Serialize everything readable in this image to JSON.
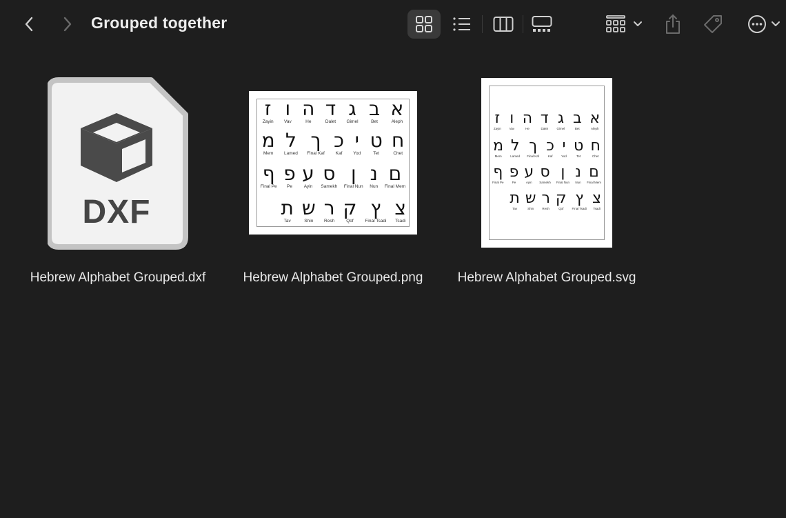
{
  "window": {
    "title": "Grouped together"
  },
  "toolbar": {
    "back": "chevron-left-icon",
    "forward": "chevron-right-icon",
    "views": [
      "grid-view-icon",
      "list-view-icon",
      "column-view-icon",
      "gallery-view-icon"
    ],
    "active_view": "grid",
    "group_by": "group-by-icon",
    "share": "share-icon",
    "tags": "tag-icon",
    "more": "ellipsis-circle-icon"
  },
  "files": [
    {
      "name": "Hebrew Alphabet Grouped.dxf",
      "kind": "document-icon",
      "icon_text": "DXF"
    },
    {
      "name": "Hebrew Alphabet Grouped.png",
      "kind": "image-thumbnail"
    },
    {
      "name": "Hebrew Alphabet Grouped.svg",
      "kind": "image-thumbnail"
    }
  ],
  "chart_sheet": {
    "rows": [
      [
        [
          "א",
          "Aleph"
        ],
        [
          "ב",
          "Bet"
        ],
        [
          "ג",
          "Gimel"
        ],
        [
          "ד",
          "Dalet"
        ],
        [
          "ה",
          "He"
        ],
        [
          "ו",
          "Vav"
        ],
        [
          "ז",
          "Zayin"
        ]
      ],
      [
        [
          "ח",
          "Chet"
        ],
        [
          "ט",
          "Tet"
        ],
        [
          "י",
          "Yod"
        ],
        [
          "כ",
          "Kaf"
        ],
        [
          "ך",
          "Final Kaf"
        ],
        [
          "ל",
          "Lamed"
        ],
        [
          "מ",
          "Mem"
        ]
      ],
      [
        [
          "ם",
          "Final Mem"
        ],
        [
          "נ",
          "Nun"
        ],
        [
          "ן",
          "Final Nun"
        ],
        [
          "ס",
          "Samekh"
        ],
        [
          "ע",
          "Ayin"
        ],
        [
          "פ",
          "Pe"
        ],
        [
          "ף",
          "Final Pe"
        ]
      ],
      [
        [
          "צ",
          "Tsadi"
        ],
        [
          "ץ",
          "Final Tsadi"
        ],
        [
          "ק",
          "Qof"
        ],
        [
          "ר",
          "Resh"
        ],
        [
          "ש",
          "Shin"
        ],
        [
          "ת",
          "Tav"
        ]
      ]
    ]
  },
  "colors": {
    "background": "#1e1e1e",
    "toolbar_icon": "#cfcfcf",
    "disabled_icon": "#6b6b6b"
  }
}
